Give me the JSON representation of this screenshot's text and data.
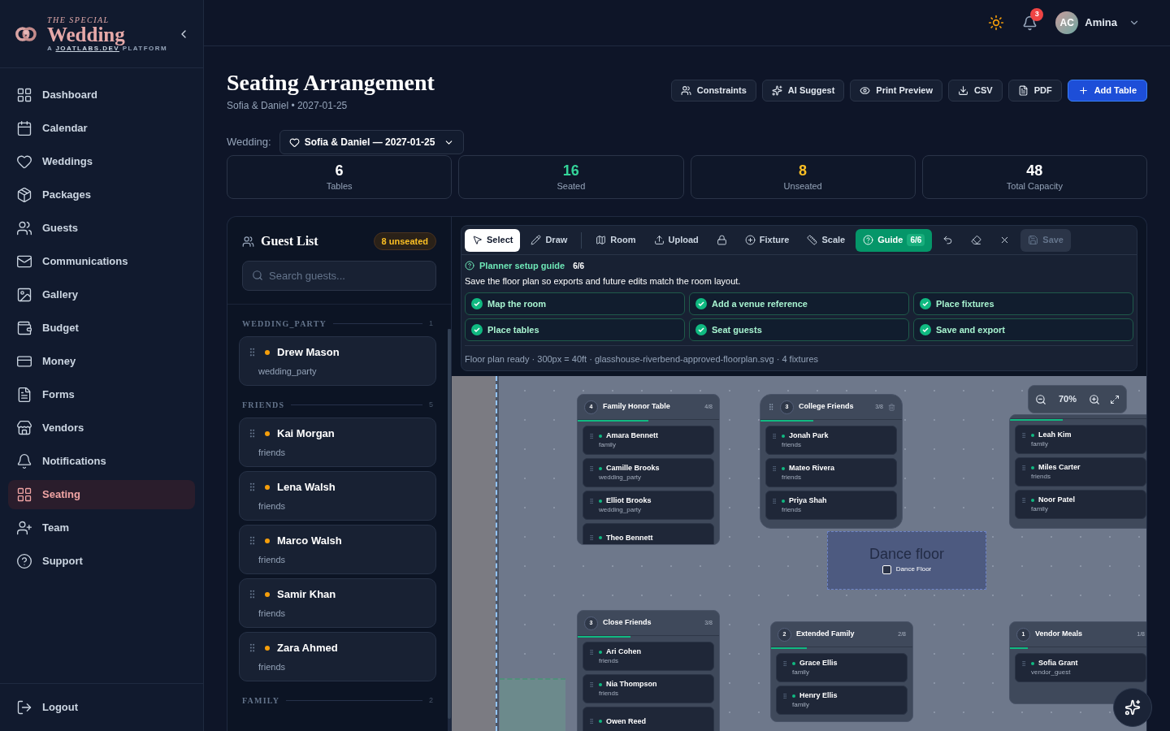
{
  "brand": {
    "kicker": "THE SPECIAL",
    "name": "Wedding",
    "tagline_prefix": "A",
    "tagline_link": "JOATLABS.DEV",
    "tagline_suffix": "PLATFORM"
  },
  "nav": [
    {
      "label": "Dashboard",
      "selected": false
    },
    {
      "label": "Calendar",
      "selected": false
    },
    {
      "label": "Weddings",
      "selected": false
    },
    {
      "label": "Packages",
      "selected": false
    },
    {
      "label": "Guests",
      "selected": false
    },
    {
      "label": "Communications",
      "selected": false
    },
    {
      "label": "Gallery",
      "selected": false
    },
    {
      "label": "Budget",
      "selected": false
    },
    {
      "label": "Money",
      "selected": false
    },
    {
      "label": "Forms",
      "selected": false
    },
    {
      "label": "Vendors",
      "selected": false
    },
    {
      "label": "Notifications",
      "selected": false
    },
    {
      "label": "Seating",
      "selected": true
    },
    {
      "label": "Team",
      "selected": false
    },
    {
      "label": "Support",
      "selected": false
    }
  ],
  "logout": "Logout",
  "topbar": {
    "notifications": "3",
    "avatar": "AC",
    "user": "Amina"
  },
  "page": {
    "title": "Seating Arrangement",
    "subtitle": "Sofia & Daniel • 2027-01-25"
  },
  "actions": [
    {
      "label": "Constraints",
      "kind": "default"
    },
    {
      "label": "AI Suggest",
      "kind": "default"
    },
    {
      "label": "Print Preview",
      "kind": "default"
    },
    {
      "label": "CSV",
      "kind": "default"
    },
    {
      "label": "PDF",
      "kind": "default"
    },
    {
      "label": "Add Table",
      "kind": "primary"
    }
  ],
  "wedding": {
    "label": "Wedding:",
    "value": "Sofia & Daniel — 2027-01-25"
  },
  "stats": [
    {
      "value": "6",
      "label": "Tables",
      "color": "#ffffff"
    },
    {
      "value": "16",
      "label": "Seated",
      "color": "#34d399"
    },
    {
      "value": "8",
      "label": "Unseated",
      "color": "#fbbf24"
    },
    {
      "value": "48",
      "label": "Total Capacity",
      "color": "#ffffff"
    }
  ],
  "guest_list": {
    "title": "Guest List",
    "badge": "8 unseated",
    "search": {
      "placeholder": "Search guests..."
    },
    "groups": [
      {
        "label": "WEDDING_PARTY",
        "count": "1",
        "guests": [
          {
            "name": "Drew Mason",
            "group": "wedding_party",
            "color": "#f59e0b"
          }
        ]
      },
      {
        "label": "FRIENDS",
        "count": "5",
        "guests": [
          {
            "name": "Kai Morgan",
            "group": "friends",
            "color": "#f59e0b"
          },
          {
            "name": "Lena Walsh",
            "group": "friends",
            "color": "#f59e0b"
          },
          {
            "name": "Marco Walsh",
            "group": "friends",
            "color": "#f59e0b"
          },
          {
            "name": "Samir Khan",
            "group": "friends",
            "color": "#f59e0b"
          },
          {
            "name": "Zara Ahmed",
            "group": "friends",
            "color": "#f59e0b"
          }
        ]
      },
      {
        "label": "FAMILY",
        "count": "2"
      }
    ]
  },
  "tools": [
    {
      "kind": "tool",
      "label": "Select",
      "selected": true,
      "disabled": false
    },
    {
      "kind": "tool",
      "label": "Draw",
      "selected": false,
      "disabled": false
    },
    {
      "kind": "tool",
      "label": "Room",
      "selected": false,
      "disabled": false
    },
    {
      "kind": "tool",
      "label": "Upload",
      "selected": false,
      "disabled": false
    },
    {
      "kind": "icon",
      "selected": false,
      "disabled": false
    },
    {
      "kind": "tool",
      "label": "Fixture",
      "selected": false,
      "disabled": false
    },
    {
      "kind": "tool",
      "label": "Scale",
      "selected": false,
      "disabled": false
    },
    {
      "kind": "guide",
      "label": "Guide",
      "badge": "6/6",
      "selected": true,
      "disabled": false
    },
    {
      "kind": "icon",
      "selected": false,
      "disabled": false
    },
    {
      "kind": "icon",
      "selected": false,
      "disabled": false
    },
    {
      "kind": "icon",
      "selected": false,
      "disabled": false
    },
    {
      "kind": "tool",
      "label": "Save",
      "selected": false,
      "disabled": true
    }
  ],
  "guide": {
    "title": "Planner setup guide",
    "progress": "6/6",
    "text": "Save the floor plan so exports and future edits match the room layout.",
    "steps": [
      {
        "label": "Map the room",
        "checked": true
      },
      {
        "label": "Add a venue reference",
        "checked": true
      },
      {
        "label": "Place fixtures",
        "checked": true
      },
      {
        "label": "Place tables",
        "checked": true
      },
      {
        "label": "Seat guests",
        "checked": true
      },
      {
        "label": "Save and export",
        "checked": true
      }
    ],
    "status": "Floor plan ready · 300px = 40ft · glasshouse-riverbend-approved-floorplan.svg · 4 fixtures"
  },
  "canvas": {
    "zoom": "70%",
    "fixtures": [
      {
        "kind": "dance_floor",
        "title": "Dance floor",
        "label": "Dance Floor"
      },
      {
        "kind": "entry"
      }
    ],
    "tables": [
      {
        "number": "4",
        "name": "Family Honor Table",
        "count": "4/8",
        "level": 0.5,
        "actions": false,
        "guests": [
          {
            "name": "Amara Bennett",
            "group": "family",
            "color": "#10b981"
          },
          {
            "name": "Camille Brooks",
            "group": "wedding_party",
            "color": "#10b981"
          },
          {
            "name": "Elliot Brooks",
            "group": "wedding_party",
            "color": "#10b981"
          },
          {
            "name": "Theo Bennett",
            "color": "#10b981"
          }
        ]
      },
      {
        "number": "3",
        "name": "College Friends",
        "count": "3/8",
        "level": 0.375,
        "actions": true,
        "guests": [
          {
            "name": "Jonah Park",
            "group": "friends",
            "color": "#10b981"
          },
          {
            "name": "Mateo Rivera",
            "group": "friends",
            "color": "#10b981"
          },
          {
            "name": "Priya Shah",
            "group": "friends",
            "color": "#10b981"
          }
        ]
      },
      {
        "level": 0.375,
        "actions": false,
        "guests": [
          {
            "name": "Leah Kim",
            "group": "family",
            "color": "#10b981"
          },
          {
            "name": "Miles Carter",
            "group": "friends",
            "color": "#10b981"
          },
          {
            "name": "Noor Patel",
            "group": "family",
            "color": "#10b981"
          }
        ]
      },
      {
        "number": "3",
        "name": "Close Friends",
        "count": "3/8",
        "level": 0.375,
        "actions": false,
        "guests": [
          {
            "name": "Ari Cohen",
            "group": "friends",
            "color": "#10b981"
          },
          {
            "name": "Nia Thompson",
            "group": "friends",
            "color": "#10b981"
          },
          {
            "name": "Owen Reed",
            "color": "#10b981"
          }
        ]
      },
      {
        "number": "2",
        "name": "Extended Family",
        "count": "2/8",
        "level": 0.25,
        "actions": false,
        "guests": [
          {
            "name": "Grace Ellis",
            "group": "family",
            "color": "#10b981"
          },
          {
            "name": "Henry Ellis",
            "group": "family",
            "color": "#10b981"
          }
        ]
      },
      {
        "number": "1",
        "name": "Vendor Meals",
        "count": "1/8",
        "level": 0.125,
        "actions": false,
        "guests": [
          {
            "name": "Sofia Grant",
            "group": "vendor_guest",
            "color": "#10b981"
          }
        ]
      }
    ]
  }
}
